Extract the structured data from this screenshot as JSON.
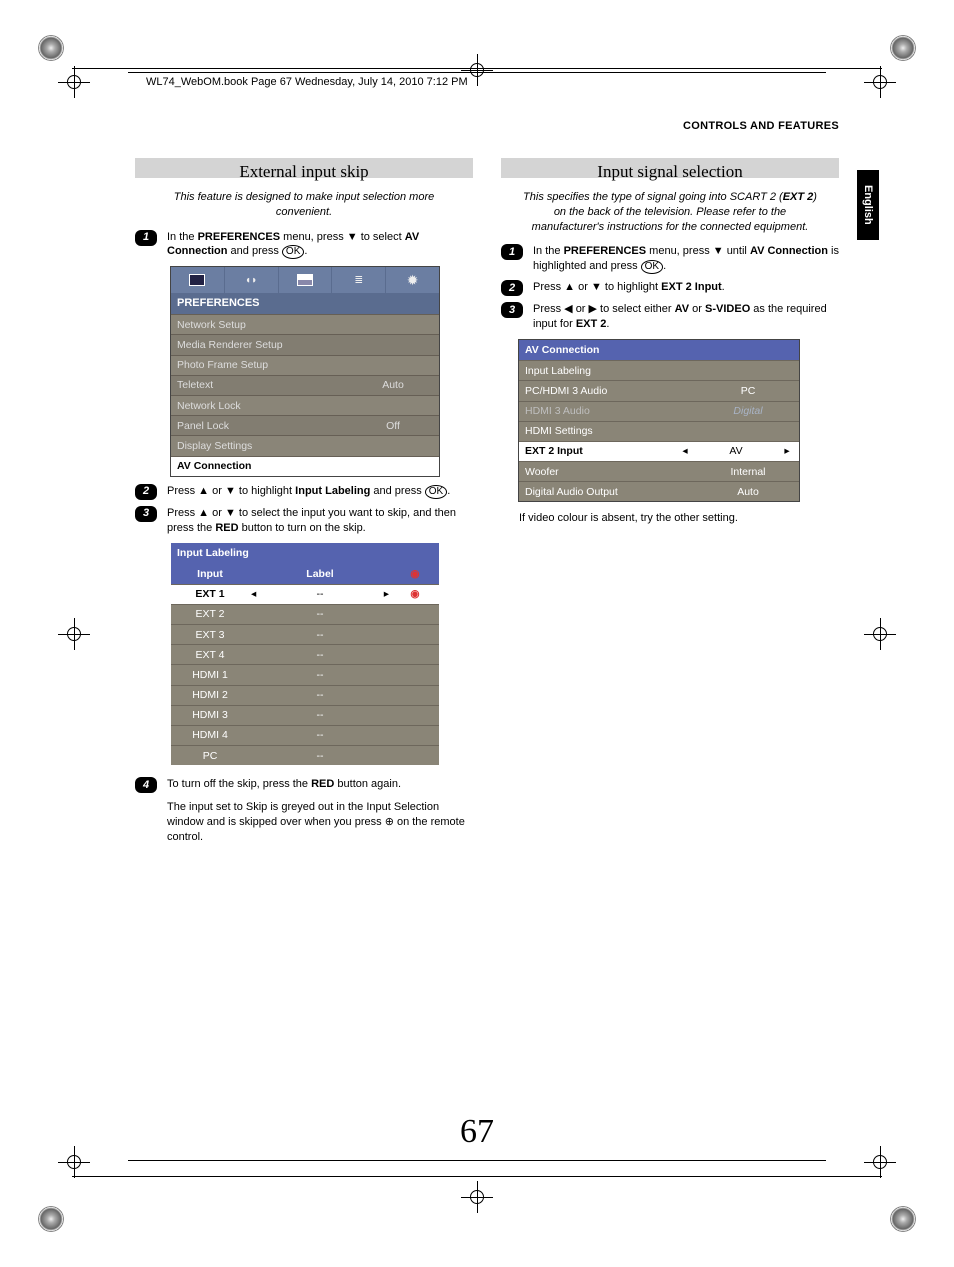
{
  "header_line": "WL74_WebOM.book  Page 67  Wednesday, July 14, 2010  7:12 PM",
  "running_head": "CONTROLS AND FEATURES",
  "lang_tab": "English",
  "page_number": "67",
  "left": {
    "title": "External input skip",
    "intro": "This feature is designed to make input selection more convenient.",
    "step1_a": "In the ",
    "step1_b": "PREFERENCES",
    "step1_c": " menu, press ▼ to select ",
    "step1_d": "AV Connection",
    "step1_e": " and press ",
    "step1_ok": "OK",
    "step1_f": ".",
    "prefs_menu": {
      "title": "PREFERENCES",
      "rows": [
        {
          "k": "Network Setup",
          "v": ""
        },
        {
          "k": "Media Renderer Setup",
          "v": ""
        },
        {
          "k": "Photo Frame Setup",
          "v": ""
        },
        {
          "k": "Teletext",
          "v": "Auto"
        },
        {
          "k": "Network Lock",
          "v": ""
        },
        {
          "k": "Panel Lock",
          "v": "Off"
        },
        {
          "k": "Display Settings",
          "v": ""
        },
        {
          "k": "AV Connection",
          "v": "",
          "sel": true
        }
      ]
    },
    "step2_a": "Press ▲ or ▼ to highlight ",
    "step2_b": "Input Labeling",
    "step2_c": " and press ",
    "step2_ok": "OK",
    "step2_d": ".",
    "step3_a": "Press  ▲ or ▼ to select the input you want to skip, and then press the ",
    "step3_b": "RED",
    "step3_c": " button to turn on the skip.",
    "input_table": {
      "title": "Input Labeling",
      "cols": [
        "Input",
        "Label",
        ""
      ],
      "rows": [
        {
          "c1": "EXT 1",
          "c2": "--",
          "sel": true
        },
        {
          "c1": "EXT 2",
          "c2": "--"
        },
        {
          "c1": "EXT 3",
          "c2": "--"
        },
        {
          "c1": "EXT 4",
          "c2": "--"
        },
        {
          "c1": "HDMI 1",
          "c2": "--"
        },
        {
          "c1": "HDMI 2",
          "c2": "--"
        },
        {
          "c1": "HDMI 3",
          "c2": "--"
        },
        {
          "c1": "HDMI 4",
          "c2": "--"
        },
        {
          "c1": "PC",
          "c2": "--"
        }
      ]
    },
    "step4_a": "To turn off the skip, press the ",
    "step4_b": "RED",
    "step4_c": " button again.",
    "note": "The input set to Skip is greyed out in the Input Selection window and is skipped over when you press ",
    "note2": " on the remote control."
  },
  "right": {
    "title": "Input signal selection",
    "intro_a": "This specifies the type of signal going into SCART 2 (",
    "intro_b": "EXT 2",
    "intro_c": ") on the back of the television. Please refer to the manufacturer's instructions for the connected equipment.",
    "step1_a": "In the ",
    "step1_b": "PREFERENCES",
    "step1_c": " menu, press ▼ until ",
    "step1_d": "AV Connection",
    "step1_e": " is highlighted and press ",
    "step1_ok": "OK",
    "step1_f": ".",
    "step2_a": "Press ▲ or ▼ to highlight ",
    "step2_b": "EXT 2 Input",
    "step2_c": ".",
    "step3_a": "Press ◀ or ▶ to select either ",
    "step3_b": "AV",
    "step3_c": " or ",
    "step3_d": "S-VIDEO",
    "step3_e": " as the required input for ",
    "step3_f": "EXT 2",
    "step3_g": ".",
    "avmenu": {
      "title": "AV Connection",
      "rows": [
        {
          "k": "Input Labeling",
          "v": ""
        },
        {
          "k": "PC/HDMI 3 Audio",
          "v": "PC"
        },
        {
          "k": "HDMI 3 Audio",
          "v": "Digital",
          "dim": true
        },
        {
          "k": "HDMI Settings",
          "v": ""
        },
        {
          "k": "EXT 2 Input",
          "v": "AV",
          "sel": true
        },
        {
          "k": "Woofer",
          "v": "Internal"
        },
        {
          "k": "Digital Audio Output",
          "v": "Auto"
        }
      ]
    },
    "footnote": "If video colour is absent, try the other setting."
  }
}
